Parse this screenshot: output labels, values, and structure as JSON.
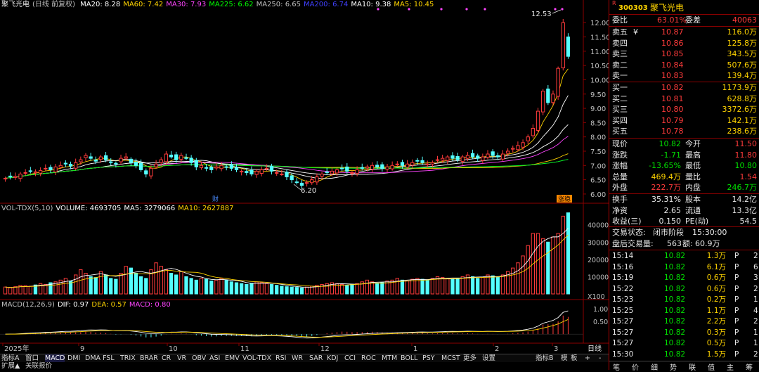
{
  "stock": {
    "name": "聚飞光电",
    "period": "(日线 前复权)",
    "code": "300303",
    "badge": "R"
  },
  "ma_legend": [
    {
      "label": "MA20: 8.28",
      "color": "#ffffff"
    },
    {
      "label": "MA60: 7.42",
      "color": "#ffd400"
    },
    {
      "label": "MA30: 7.93",
      "color": "#ff44ff"
    },
    {
      "label": "MA225: 6.62",
      "color": "#00ff00"
    },
    {
      "label": "MA250: 6.65",
      "color": "#c0c0c0"
    },
    {
      "label": "MA200: 6.74",
      "color": "#4040ff"
    },
    {
      "label": "MA10: 9.38",
      "color": "#ffffff"
    },
    {
      "label": "MA5: 10.45",
      "color": "#ffd400"
    }
  ],
  "vol_legend": [
    {
      "label": "VOL-TDX(5,10)",
      "color": "#c0c0c0"
    },
    {
      "label": "VOLUME: 4693705",
      "color": "#ffffff"
    },
    {
      "label": "MA5: 3279066",
      "color": "#ffffff"
    },
    {
      "label": "MA10: 2627887",
      "color": "#ffd400"
    }
  ],
  "macd_legend": [
    {
      "label": "MACD(12,26,9)",
      "color": "#c0c0c0"
    },
    {
      "label": "DIF: 0.97",
      "color": "#ffffff"
    },
    {
      "label": "DEA: 0.57",
      "color": "#ffd400"
    },
    {
      "label": "MACD: 0.80",
      "color": "#ff44ff"
    }
  ],
  "price_axis": [
    "12.00",
    "11.50",
    "11.00",
    "10.50",
    "10.00",
    "9.50",
    "9.00",
    "8.50",
    "8.00",
    "7.50",
    "7.00",
    "6.50",
    "6.00"
  ],
  "vol_axis": [
    "40000",
    "30000",
    "20000",
    "10000",
    "X100"
  ],
  "macd_axis": [
    "1.00",
    "0.50"
  ],
  "annotations": {
    "high": "12.53",
    "low": "6.20",
    "cai": "财",
    "zhang": "涨稳"
  },
  "date_labels": [
    "2025年",
    "9",
    "10",
    "11",
    "12",
    "1",
    "2",
    "3"
  ],
  "date_axis_label": "日线",
  "chart_data": [
    {
      "type": "candlestick",
      "title": "聚飞光电(日线 前复权)",
      "ylim": [
        6.0,
        12.5
      ],
      "high_marker": 12.53,
      "low_marker": 6.2,
      "closes": [
        6.55,
        6.6,
        6.62,
        6.7,
        6.75,
        6.8,
        6.78,
        6.82,
        6.9,
        6.85,
        6.95,
        7.0,
        7.05,
        6.98,
        7.1,
        7.2,
        7.35,
        7.25,
        7.15,
        7.3,
        7.2,
        7.1,
        7.05,
        7.25,
        7.3,
        7.1,
        7.0,
        6.85,
        6.7,
        6.9,
        7.05,
        7.2,
        7.4,
        7.3,
        7.2,
        7.35,
        7.25,
        7.1,
        6.95,
        7.0,
        6.9,
        6.85,
        6.95,
        7.0,
        6.95,
        6.9,
        6.85,
        6.8,
        6.75,
        6.7,
        6.8,
        6.85,
        6.9,
        6.8,
        6.75,
        6.7,
        6.6,
        6.5,
        6.4,
        6.3,
        6.4,
        6.5,
        6.6,
        6.7,
        6.75,
        6.8,
        6.85,
        6.9,
        6.8,
        6.75,
        6.85,
        6.9,
        6.95,
        7.0,
        6.95,
        6.9,
        6.95,
        7.0,
        7.05,
        7.0,
        7.05,
        7.1,
        7.15,
        7.1,
        7.05,
        7.1,
        7.2,
        7.25,
        7.3,
        7.25,
        7.2,
        7.3,
        7.35,
        7.3,
        7.25,
        7.3,
        7.4,
        7.35,
        7.3,
        7.4,
        7.5,
        7.6,
        7.7,
        7.8,
        8.0,
        8.3,
        8.9,
        9.6,
        9.2,
        9.5,
        10.4,
        12.0,
        10.82
      ]
    },
    {
      "type": "bar",
      "title": "VOL-TDX(5,10)",
      "ylim": [
        0,
        48000
      ],
      "values": [
        4000,
        3500,
        4200,
        5000,
        4800,
        4500,
        5200,
        6000,
        5500,
        6500,
        7000,
        8000,
        9000,
        7500,
        11000,
        14000,
        12000,
        10000,
        9500,
        13000,
        11000,
        9000,
        8500,
        12000,
        16000,
        15000,
        12000,
        10000,
        9000,
        14000,
        18000,
        16000,
        14000,
        12000,
        11000,
        13000,
        10000,
        9000,
        8000,
        9000,
        8500,
        7500,
        8000,
        9000,
        8000,
        7000,
        6500,
        6000,
        5500,
        6000,
        7000,
        6500,
        6000,
        5500,
        5000,
        4500,
        4200,
        4000,
        3800,
        3500,
        4000,
        4500,
        5000,
        5500,
        6000,
        6500,
        6000,
        5500,
        5000,
        5500,
        6000,
        7000,
        8000,
        7000,
        6000,
        6500,
        7500,
        8000,
        9000,
        8000,
        7500,
        8500,
        9000,
        8500,
        8000,
        9000,
        10000,
        9500,
        9000,
        8500,
        9000,
        10000,
        11000,
        10000,
        9000,
        9500,
        11000,
        10500,
        10000,
        11000,
        13000,
        15000,
        18000,
        22000,
        28000,
        35000,
        35000,
        32000,
        30000,
        33000,
        35000,
        45000,
        46937
      ]
    },
    {
      "type": "bar",
      "title": "MACD(12,26,9)",
      "ylim": [
        -0.3,
        1.2
      ],
      "dif": 0.97,
      "dea": 0.57,
      "macd": 0.8
    }
  ],
  "quote": {
    "weibi_label": "委比",
    "weibi_value": "63.01%",
    "weicha_label": "委差",
    "weicha_value": "40063",
    "asks": [
      {
        "label": "卖五",
        "price": "10.87",
        "vol": "116.0万",
        "mark": "¥"
      },
      {
        "label": "卖四",
        "price": "10.86",
        "vol": "125.8万",
        "mark": ""
      },
      {
        "label": "卖三",
        "price": "10.85",
        "vol": "343.5万",
        "mark": ""
      },
      {
        "label": "卖二",
        "price": "10.84",
        "vol": "507.6万",
        "mark": ""
      },
      {
        "label": "卖一",
        "price": "10.83",
        "vol": "139.4万",
        "mark": ""
      }
    ],
    "bids": [
      {
        "label": "买一",
        "price": "10.82",
        "vol": "1173.9万"
      },
      {
        "label": "买二",
        "price": "10.81",
        "vol": "628.8万"
      },
      {
        "label": "买三",
        "price": "10.80",
        "vol": "3372.6万"
      },
      {
        "label": "买四",
        "price": "10.79",
        "vol": "142.1万"
      },
      {
        "label": "买五",
        "price": "10.78",
        "vol": "238.6万"
      }
    ],
    "stats": [
      {
        "l1": "现价",
        "v1": "10.82",
        "c1": "grn",
        "l2": "今开",
        "v2": "11.50",
        "c2": "red"
      },
      {
        "l1": "涨跌",
        "v1": "-1.71",
        "c1": "grn",
        "l2": "最高",
        "v2": "11.80",
        "c2": "red"
      },
      {
        "l1": "涨幅",
        "v1": "-13.65%",
        "c1": "grn",
        "l2": "最低",
        "v2": "10.80",
        "c2": "grn"
      },
      {
        "l1": "总量",
        "v1": "469.4万",
        "c1": "yel",
        "l2": "量比",
        "v2": "1.54",
        "c2": "red"
      },
      {
        "l1": "外盘",
        "v1": "222.7万",
        "c1": "red",
        "l2": "内盘",
        "v2": "246.7万",
        "c2": "grn"
      }
    ],
    "stats2": [
      {
        "l1": "换手",
        "v1": "35.31%",
        "l2": "股本",
        "v2": "14.2亿"
      },
      {
        "l1": "净资",
        "v1": "2.65",
        "l2": "流通",
        "v2": "13.3亿"
      },
      {
        "l1": "收益(三)",
        "v1": "0.150",
        "l2": "PE(动)",
        "v2": "54.5"
      }
    ],
    "trade_state_label": "交易状态:",
    "trade_state_value": "闭市阶段",
    "trade_state_time": "15:30:00",
    "after_label": "盘后交易量:",
    "after_vol": "563",
    "after_amt_label": "额:",
    "after_amt": "60.9万"
  },
  "ticks": [
    {
      "time": "15:14",
      "price": "10.82",
      "vol": "1.3万",
      "side": "P",
      "n": "2"
    },
    {
      "time": "15:16",
      "price": "10.82",
      "vol": "6.1万",
      "side": "P",
      "n": "6"
    },
    {
      "time": "15:19",
      "price": "10.82",
      "vol": "0.6万",
      "side": "P",
      "n": "3"
    },
    {
      "time": "15:22",
      "price": "10.82",
      "vol": "0.6万",
      "side": "P",
      "n": "2"
    },
    {
      "time": "15:23",
      "price": "10.82",
      "vol": "0.2万",
      "side": "P",
      "n": "1"
    },
    {
      "time": "15:25",
      "price": "10.82",
      "vol": "1.1万",
      "side": "P",
      "n": "4"
    },
    {
      "time": "15:27",
      "price": "10.82",
      "vol": "2.2万",
      "side": "P",
      "n": "2"
    },
    {
      "time": "15:27",
      "price": "10.82",
      "vol": "0.3万",
      "side": "P",
      "n": "1"
    },
    {
      "time": "15:27",
      "price": "10.82",
      "vol": "0.5万",
      "side": "P",
      "n": "1"
    },
    {
      "time": "15:30",
      "price": "10.82",
      "vol": "1.5万",
      "side": "P",
      "n": "2"
    }
  ],
  "tabs": [
    "指标A",
    "窗口",
    "MACD",
    "DMI",
    "DMA",
    "FSL",
    "TRIX",
    "BRAR",
    "CR",
    "VR",
    "OBV",
    "ASI",
    "EMV",
    "VOL-TDX",
    "RSI",
    "WR",
    "SAR",
    "KDJ",
    "CCI",
    "ROC",
    "MTM",
    "BOLL",
    "PSY",
    "MCST",
    "更多",
    "设置",
    "指标B",
    "模",
    "板",
    "+",
    "-"
  ],
  "footer": {
    "expand": "扩展▲",
    "related": "关联报价"
  },
  "right_tabs": [
    "笔",
    "价",
    "细",
    "势",
    "联",
    "值",
    "主",
    "筹"
  ]
}
